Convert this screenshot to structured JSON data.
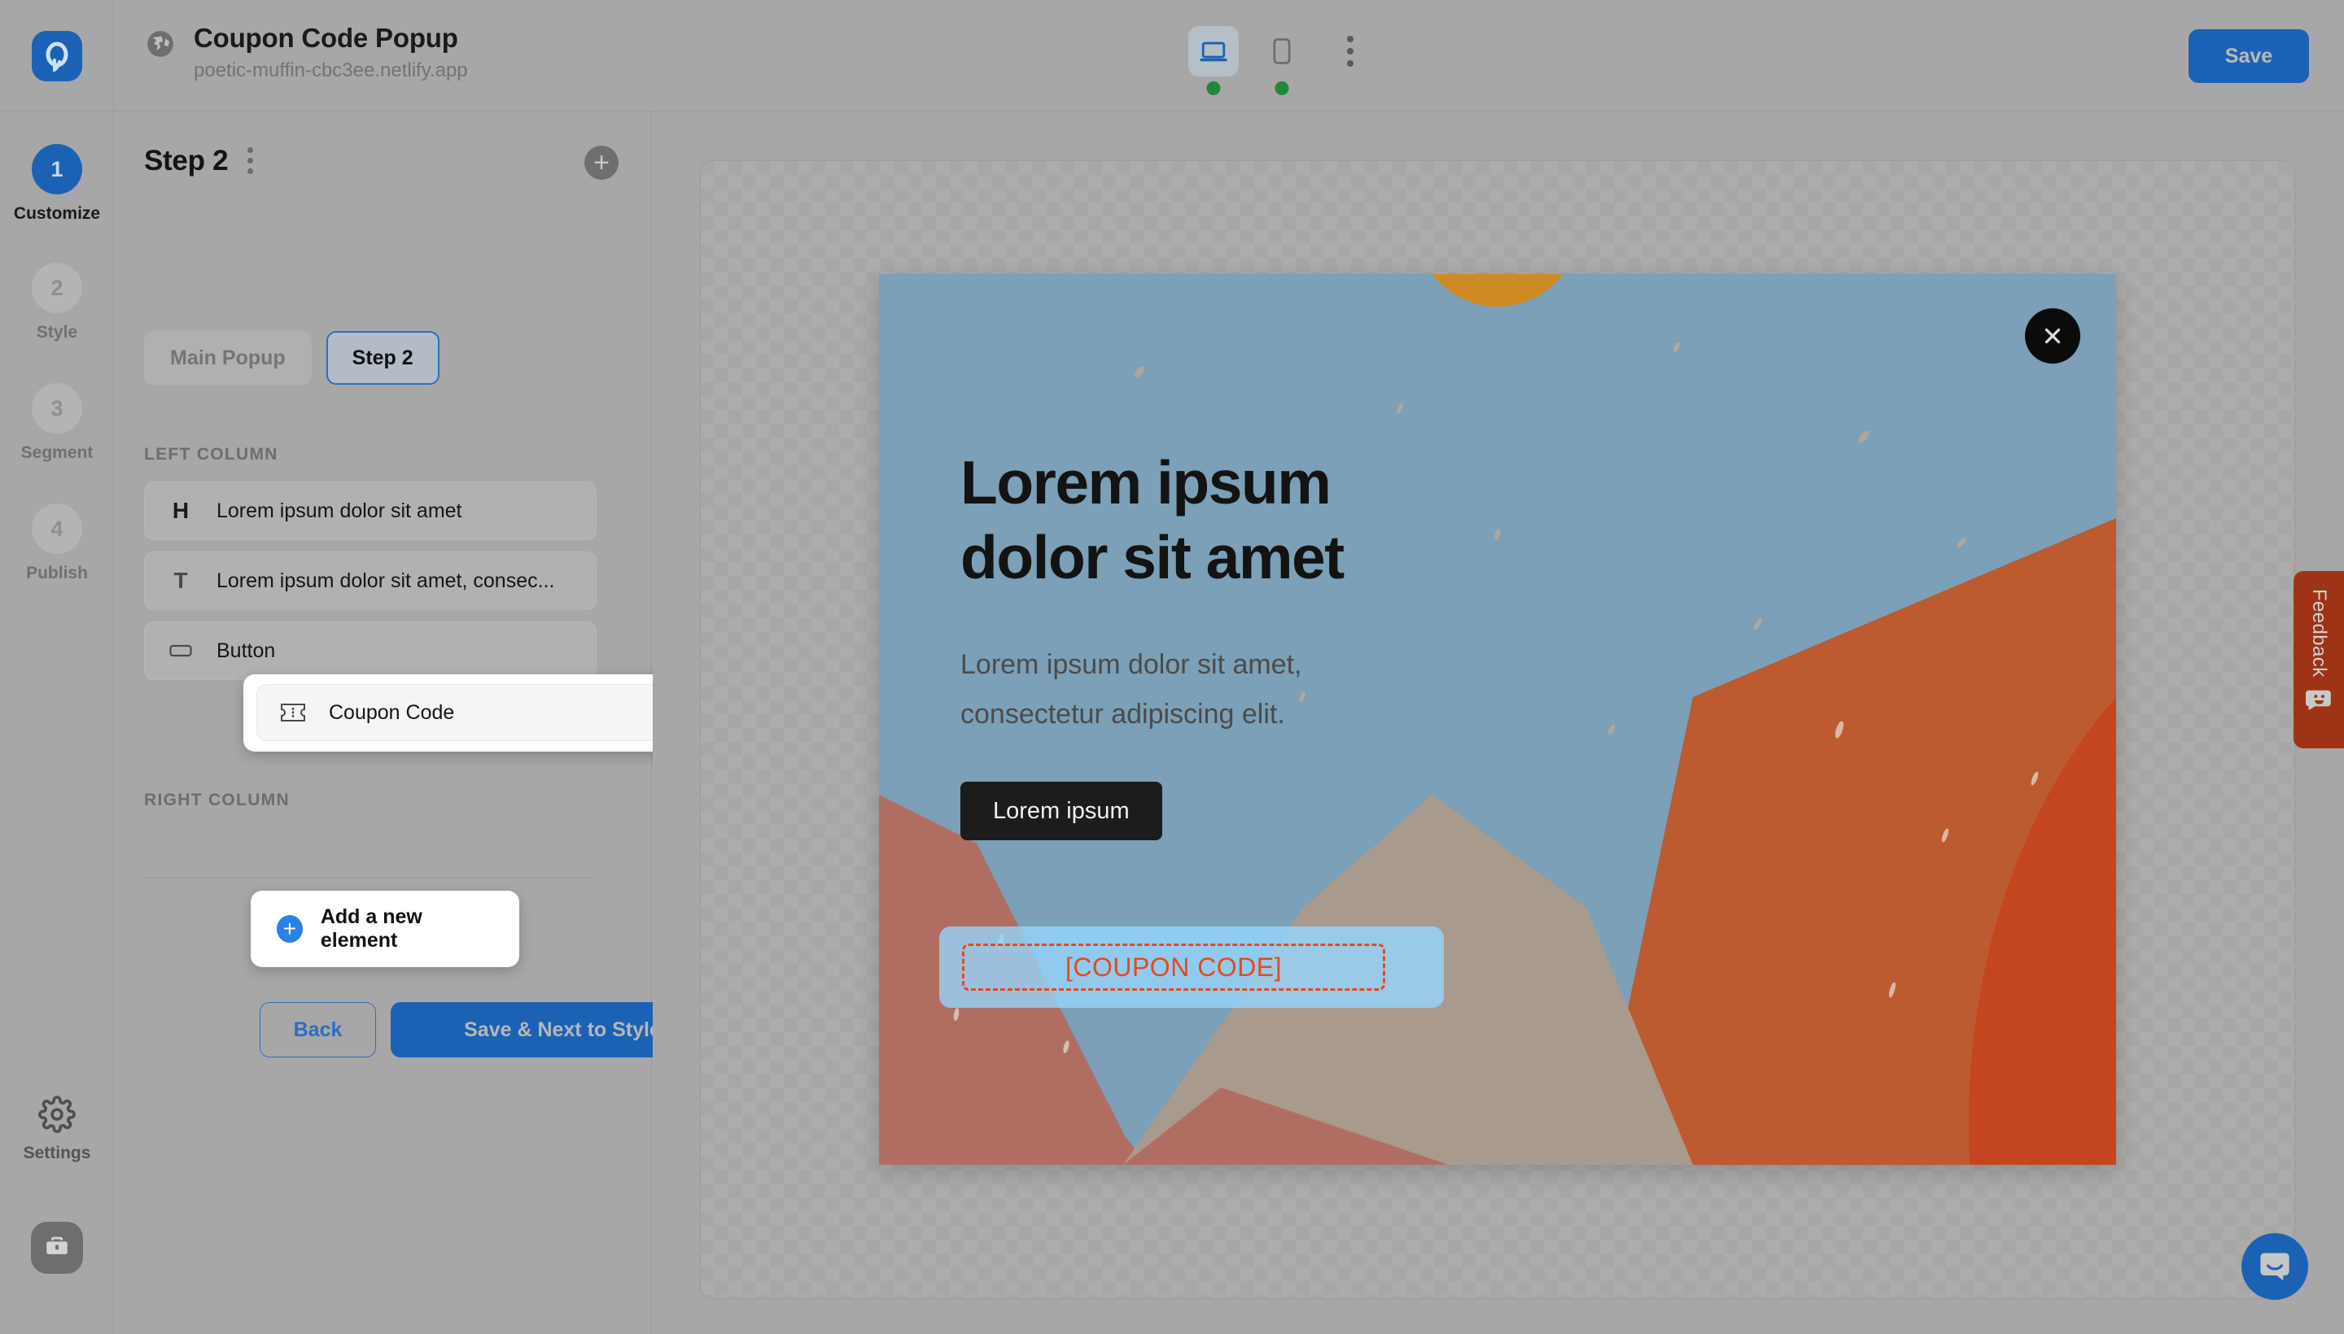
{
  "header": {
    "logo_icon": "brand-logo-icon",
    "globe_icon": "globe-icon",
    "site_title": "Coupon Code Popup",
    "site_url": "poetic-muffin-cbc3ee.netlify.app",
    "save_label": "Save",
    "devices": [
      {
        "name": "desktop",
        "icon": "desktop-icon",
        "active": true,
        "status": "online"
      },
      {
        "name": "mobile",
        "icon": "mobile-icon",
        "active": false,
        "status": "online"
      }
    ],
    "more_icon": "kebab-menu-icon"
  },
  "rail": {
    "steps": [
      {
        "number": "1",
        "label": "Customize",
        "active": true
      },
      {
        "number": "2",
        "label": "Style",
        "active": false
      },
      {
        "number": "3",
        "label": "Segment",
        "active": false
      },
      {
        "number": "4",
        "label": "Publish",
        "active": false
      }
    ],
    "settings_label": "Settings",
    "settings_icon": "gear-icon",
    "avatar_icon": "briefcase-icon"
  },
  "panel": {
    "title": "Step 2",
    "kebab_icon": "kebab-menu-icon",
    "add_icon": "plus-circle-icon",
    "tabs": [
      {
        "label": "Main Popup",
        "active": false
      },
      {
        "label": "Step 2",
        "active": true
      }
    ],
    "left_column_label": "LEFT COLUMN",
    "right_column_label": "RIGHT COLUMN",
    "elements": [
      {
        "icon": "heading-icon",
        "icon_glyph": "H",
        "label": "Lorem ipsum dolor sit amet"
      },
      {
        "icon": "text-icon",
        "icon_glyph": "T",
        "label": "Lorem ipsum dolor sit amet, consec..."
      },
      {
        "icon": "button-icon",
        "icon_glyph": "",
        "label": "Button"
      }
    ],
    "dragged_element": {
      "icon": "coupon-ticket-icon",
      "label": "Coupon Code"
    },
    "add_element_label": "Add a new element",
    "add_element_icon": "plus-icon",
    "back_label": "Back",
    "next_label": "Save & Next to Style"
  },
  "popup": {
    "heading": "Lorem ipsum dolor sit amet",
    "subtitle": "Lorem ipsum dolor sit amet, consectetur adipiscing elit.",
    "cta_label": "Lorem ipsum",
    "close_icon": "close-icon",
    "coupon_placeholder": "[COUPON CODE]",
    "colors": {
      "sky": "#7ba0b7",
      "sun": "#cf8a23",
      "left_hill": "#b06e62",
      "mid_hill": "#a99a8e",
      "right_hill": "#bc5a30",
      "far_right_hill": "#c4461f",
      "sand": "#f6e3d2",
      "pink": "#f49e92",
      "cta_bg": "#1c1c1c",
      "coupon_accent": "#e8481d",
      "drop_highlight": "#96d7ff"
    }
  },
  "feedback": {
    "label": "Feedback",
    "icon": "feedback-smiley-icon",
    "color": "#9e3316"
  },
  "intercom": {
    "icon": "chat-bubble-icon",
    "color": "#1b62b5"
  }
}
